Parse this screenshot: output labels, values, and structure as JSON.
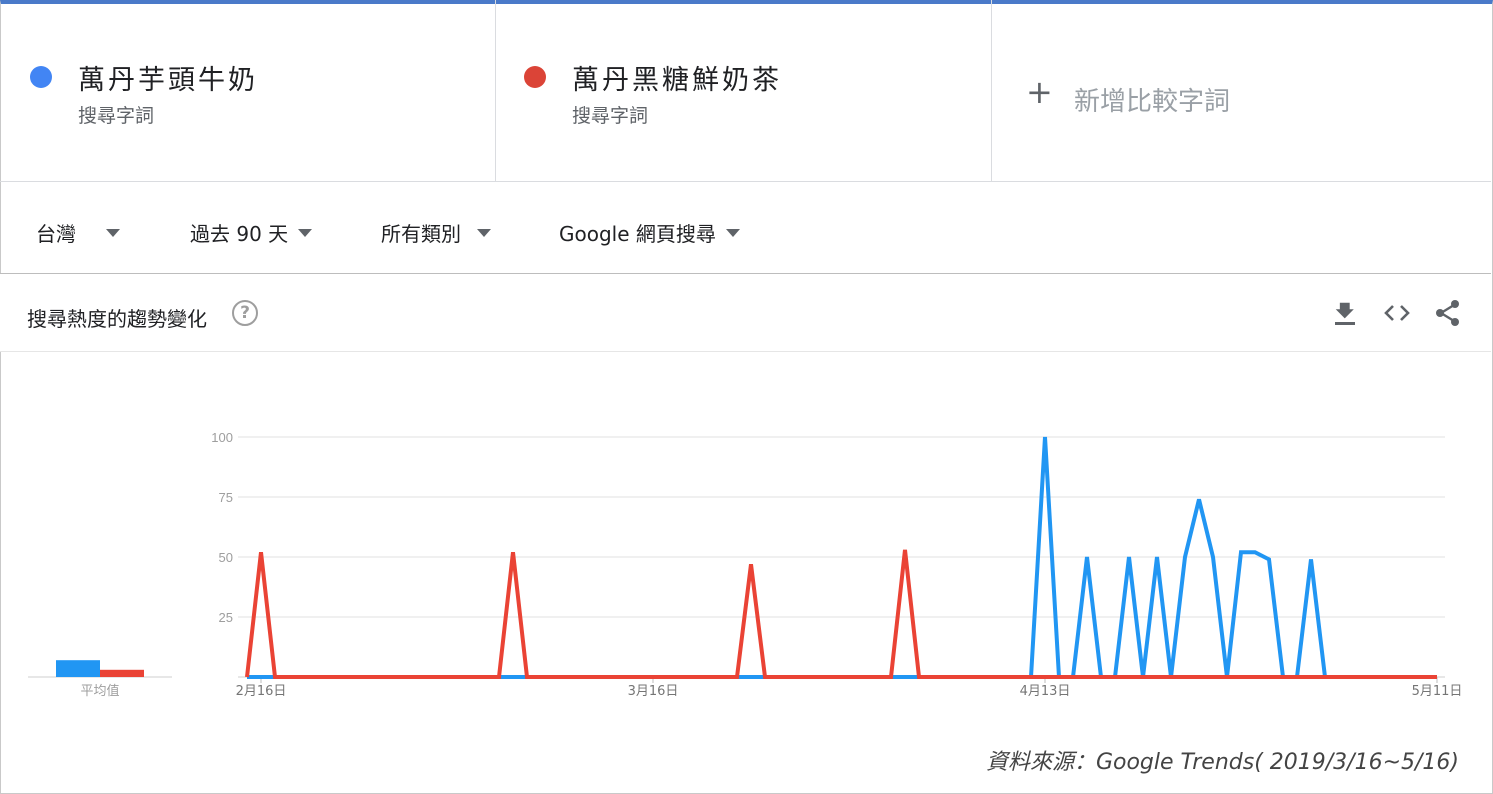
{
  "terms": [
    {
      "name": "萬丹芋頭牛奶",
      "sub": "搜尋字詞",
      "color": "#4285f4"
    },
    {
      "name": "萬丹黑糖鮮奶茶",
      "sub": "搜尋字詞",
      "color": "#db4437"
    }
  ],
  "add_term": {
    "label": "新增比較字詞",
    "icon": "plus-icon"
  },
  "filters": {
    "region": "台灣",
    "period": "過去 90 天",
    "category": "所有類別",
    "search_type": "Google 網頁搜尋"
  },
  "card": {
    "title": "搜尋熱度的趨勢變化",
    "help": "?",
    "tools": [
      "download-icon",
      "embed-icon",
      "share-icon"
    ]
  },
  "source": "資料來源：Google Trends( 2019/3/16~5/16)",
  "chart_data": {
    "type": "line",
    "title": "",
    "xlabel": "",
    "ylabel": "",
    "ylim": [
      0,
      100
    ],
    "yticks": [
      25,
      50,
      75,
      100
    ],
    "xtick_labels": [
      {
        "label": "2月16日",
        "index": 1
      },
      {
        "label": "3月16日",
        "index": 29
      },
      {
        "label": "4月13日",
        "index": 57
      },
      {
        "label": "5月11日",
        "index": 85
      }
    ],
    "average": {
      "label": "平均值",
      "values": [
        7,
        3
      ]
    },
    "grid": true,
    "series": [
      {
        "name": "萬丹芋頭牛奶",
        "color": "#2196f3",
        "values": [
          0,
          0,
          0,
          0,
          0,
          0,
          0,
          0,
          0,
          0,
          0,
          0,
          0,
          0,
          0,
          0,
          0,
          0,
          0,
          0,
          0,
          0,
          0,
          0,
          0,
          0,
          0,
          0,
          0,
          0,
          0,
          0,
          0,
          0,
          0,
          0,
          0,
          0,
          0,
          0,
          0,
          0,
          0,
          0,
          0,
          0,
          0,
          0,
          0,
          0,
          0,
          0,
          0,
          0,
          0,
          0,
          0,
          100,
          0,
          0,
          50,
          0,
          0,
          50,
          0,
          50,
          0,
          50,
          74,
          50,
          0,
          52,
          52,
          49,
          0,
          0,
          49,
          0,
          0,
          0,
          0,
          0,
          0,
          0,
          0,
          0
        ]
      },
      {
        "name": "萬丹黑糖鮮奶茶",
        "color": "#ea4335",
        "values": [
          0,
          52,
          0,
          0,
          0,
          0,
          0,
          0,
          0,
          0,
          0,
          0,
          0,
          0,
          0,
          0,
          0,
          0,
          0,
          52,
          0,
          0,
          0,
          0,
          0,
          0,
          0,
          0,
          0,
          0,
          0,
          0,
          0,
          0,
          0,
          0,
          47,
          0,
          0,
          0,
          0,
          0,
          0,
          0,
          0,
          0,
          0,
          53,
          0,
          0,
          0,
          0,
          0,
          0,
          0,
          0,
          0,
          0,
          0,
          0,
          0,
          0,
          0,
          0,
          0,
          0,
          0,
          0,
          0,
          0,
          0,
          0,
          0,
          0,
          0,
          0,
          0,
          0,
          0,
          0,
          0,
          0,
          0,
          0,
          0,
          0
        ]
      }
    ]
  }
}
